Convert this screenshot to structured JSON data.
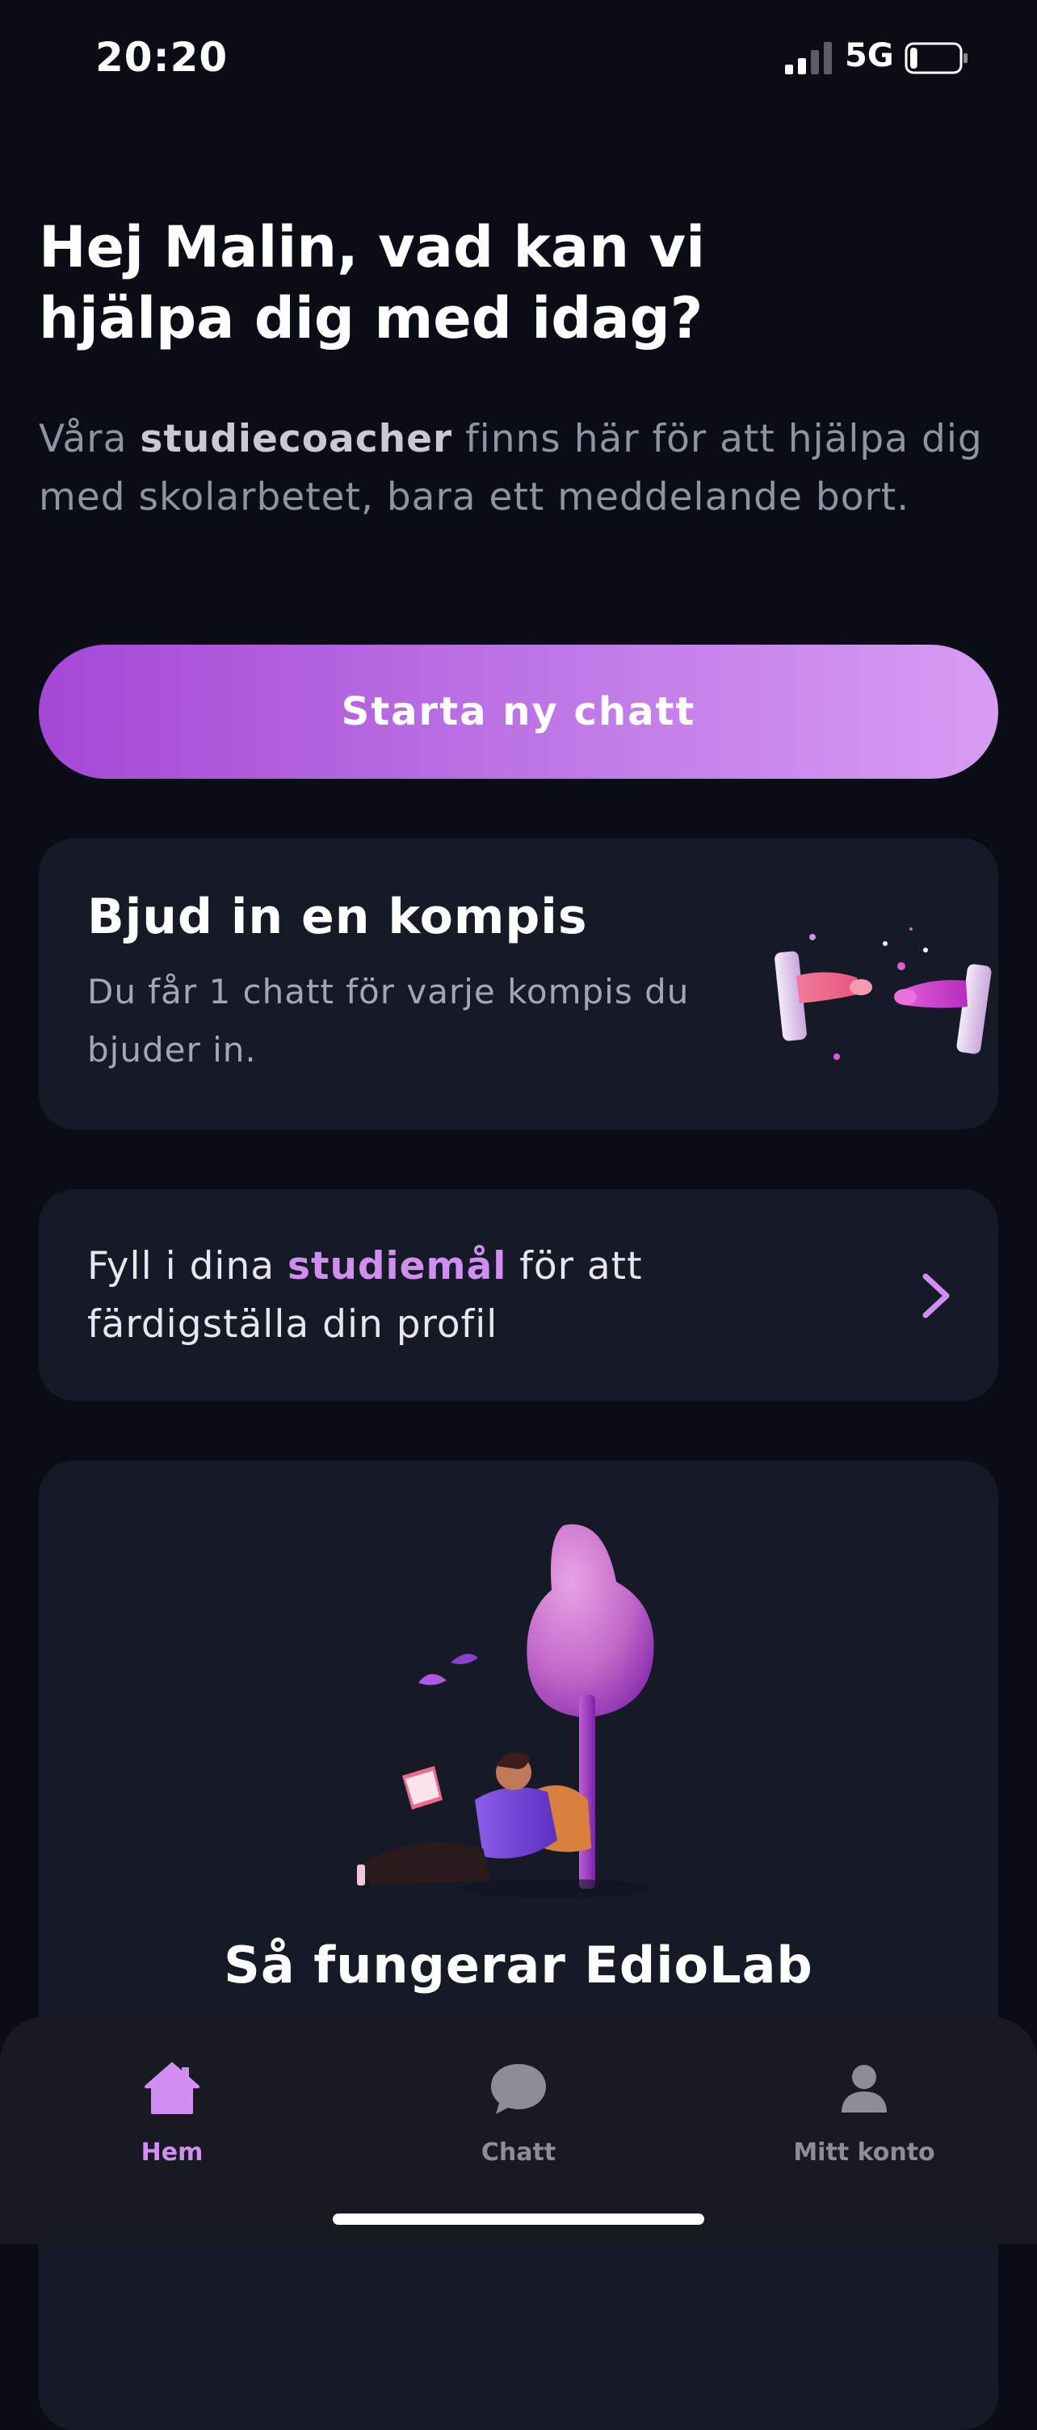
{
  "status_bar": {
    "time": "20:20",
    "network": "5G",
    "signal_bars_active": 2,
    "signal_bars_total": 4,
    "battery_level": 0.15
  },
  "home": {
    "greeting": "Hej Malin, vad kan vi hjälpa dig med idag?",
    "intro": {
      "prefix": "Våra ",
      "emphasis": "studiecoacher",
      "suffix": " finns här för att hjälpa dig med skolarbetet, bara ett meddelande bort."
    },
    "start_chat_label": "Starta ny chatt",
    "invite_card": {
      "title": "Bjud in en kompis",
      "description": "Du får 1 chatt för varje kompis du bjuder in."
    },
    "goals_card": {
      "prefix": "Fyll i dina ",
      "emphasis": "studiemål",
      "suffix": " för att färdigställa din profil"
    },
    "how_it_works_title": "Så fungerar EdioLab"
  },
  "tab_bar": {
    "active": "Hem",
    "tabs": [
      {
        "label": "Hem",
        "icon": "house-icon"
      },
      {
        "label": "Chatt",
        "icon": "chat-bubble-icon"
      },
      {
        "label": "Mitt konto",
        "icon": "person-icon"
      }
    ]
  },
  "colors": {
    "background": "#0a0d15",
    "card": "#161a26",
    "accent": "#d08ff0",
    "button_gradient_start": "#a448d6",
    "button_gradient_end": "#d89cf4",
    "muted_text": "#8f94a3"
  }
}
